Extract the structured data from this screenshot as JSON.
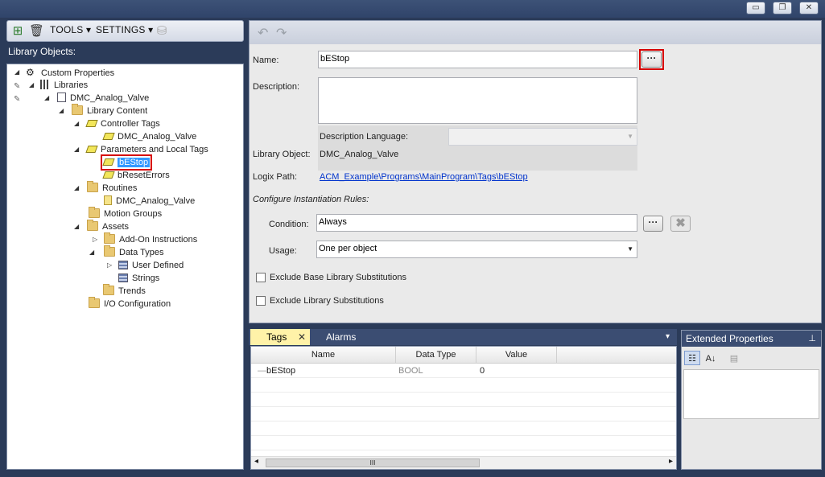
{
  "window": {
    "minimize_glyph": "▭",
    "restore_glyph": "❐",
    "close_glyph": "✕"
  },
  "left_toolbar": {
    "tools_label": "TOOLS",
    "settings_label": "SETTINGS",
    "menu_arrow": "▾"
  },
  "library_objects_title": "Library Objects:",
  "tree": [
    {
      "label": "Custom Properties",
      "icon": "gear-icon"
    },
    {
      "label": "Libraries",
      "icon": "library-icon"
    },
    {
      "label": "DMC_Analog_Valve",
      "icon": "document-icon"
    },
    {
      "label": "Library Content",
      "icon": "folder-icon"
    },
    {
      "label": "Controller Tags",
      "icon": "tag-icon"
    },
    {
      "label": "DMC_Analog_Valve",
      "icon": "tag-icon"
    },
    {
      "label": "Parameters and Local Tags",
      "icon": "tag-icon"
    },
    {
      "label": "bEStop",
      "icon": "tag-icon",
      "selected": true
    },
    {
      "label": "bResetErrors",
      "icon": "tag-icon"
    },
    {
      "label": "Routines",
      "icon": "folder-icon"
    },
    {
      "label": "DMC_Analog_Valve",
      "icon": "routine-icon"
    },
    {
      "label": "Motion Groups",
      "icon": "folder-icon"
    },
    {
      "label": "Assets",
      "icon": "folder-icon"
    },
    {
      "label": "Add-On Instructions",
      "icon": "folder-icon"
    },
    {
      "label": "Data Types",
      "icon": "folder-icon"
    },
    {
      "label": "User Defined",
      "icon": "data-type-icon"
    },
    {
      "label": "Strings",
      "icon": "data-type-icon"
    },
    {
      "label": "Trends",
      "icon": "folder-icon"
    },
    {
      "label": "I/O Configuration",
      "icon": "folder-icon"
    }
  ],
  "properties": {
    "name_label": "Name:",
    "name_value": "bEStop",
    "ellipsis": "···",
    "description_label": "Description:",
    "description_value": "",
    "description_language_label": "Description Language:",
    "description_language_value": "",
    "library_object_label": "Library Object:",
    "library_object_value": "DMC_Analog_Valve",
    "logix_path_label": "Logix Path:",
    "logix_path_value": "ACM_Example\\Programs\\MainProgram\\Tags\\bEStop",
    "configure_rules_label": "Configure Instantiation Rules:",
    "condition_label": "Condition:",
    "condition_value": "Always",
    "clear_glyph": "✖",
    "usage_label": "Usage:",
    "usage_value": "One per object",
    "exclude_base_label": "Exclude Base Library Substitutions",
    "exclude_library_label": "Exclude Library Substitutions"
  },
  "bottom_tabs": {
    "tags_label": "Tags",
    "alarms_label": "Alarms",
    "close_glyph": "✕",
    "menu_glyph": "▾"
  },
  "grid": {
    "columns": [
      "Name",
      "Data Type",
      "Value"
    ],
    "rows": [
      {
        "name": "bEStop",
        "data_type": "BOOL",
        "value": "0"
      }
    ],
    "scroll_left": "◂",
    "scroll_right": "▸",
    "scroll_thumb": "III"
  },
  "extended_properties": {
    "title": "Extended Properties",
    "pin_glyph": "📌"
  }
}
